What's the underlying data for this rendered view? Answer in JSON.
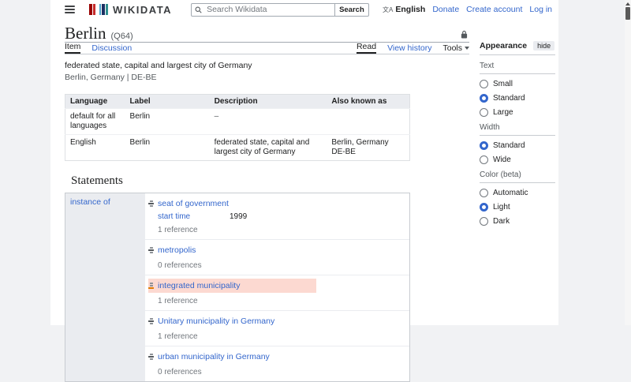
{
  "header": {
    "logo_text": "WIKIDATA",
    "search": {
      "placeholder": "Search Wikidata",
      "button_label": "Search"
    },
    "language": {
      "label": "English"
    },
    "links": {
      "donate": "Donate",
      "create_account": "Create account",
      "log_in": "Log in"
    }
  },
  "title": {
    "label": "Berlin",
    "qid": "(Q64)"
  },
  "tabs": {
    "item": "Item",
    "discussion": "Discussion",
    "read": "Read",
    "view_history": "View history",
    "tools": "Tools"
  },
  "entity": {
    "description": "federated state, capital and largest city of Germany",
    "aliases": "Berlin, Germany | DE-BE"
  },
  "term_table": {
    "headers": {
      "language": "Language",
      "label": "Label",
      "description": "Description",
      "also_known_as": "Also known as"
    },
    "rows": [
      {
        "language": "default for all languages",
        "label": "Berlin",
        "description": "–",
        "aliases": [
          "",
          ""
        ]
      },
      {
        "language": "English",
        "label": "Berlin",
        "description": "federated state, capital and largest city of Germany",
        "aliases": [
          "Berlin, Germany",
          "DE-BE"
        ]
      }
    ]
  },
  "statements": {
    "heading": "Statements",
    "property": "instance of",
    "items": [
      {
        "value": "seat of government",
        "qualifier_property": "start time",
        "qualifier_value": "1999",
        "references": "1 reference"
      },
      {
        "value": "metropolis",
        "references": "0 references"
      },
      {
        "value": "integrated municipality",
        "references": "1 reference"
      },
      {
        "value": "Unitary municipality in Germany",
        "references": "1 reference"
      },
      {
        "value": "urban municipality in Germany",
        "references": "0 references"
      }
    ]
  },
  "appearance": {
    "heading": "Appearance",
    "hide_label": "hide",
    "sections": [
      {
        "label": "Text",
        "options": [
          {
            "label": "Small"
          },
          {
            "label": "Standard"
          },
          {
            "label": "Large"
          }
        ]
      },
      {
        "label": "Width",
        "options": [
          {
            "label": "Standard"
          },
          {
            "label": "Wide"
          }
        ]
      },
      {
        "label": "Color (beta)",
        "options": [
          {
            "label": "Automatic"
          },
          {
            "label": "Light"
          },
          {
            "label": "Dark"
          }
        ]
      }
    ]
  },
  "colors": {
    "link_blue": "#3366cc",
    "deprecated_statement_bg": "#fcd9d1",
    "property_cell_bg": "#eaecf0",
    "page_bg": "#f1f2f4"
  }
}
